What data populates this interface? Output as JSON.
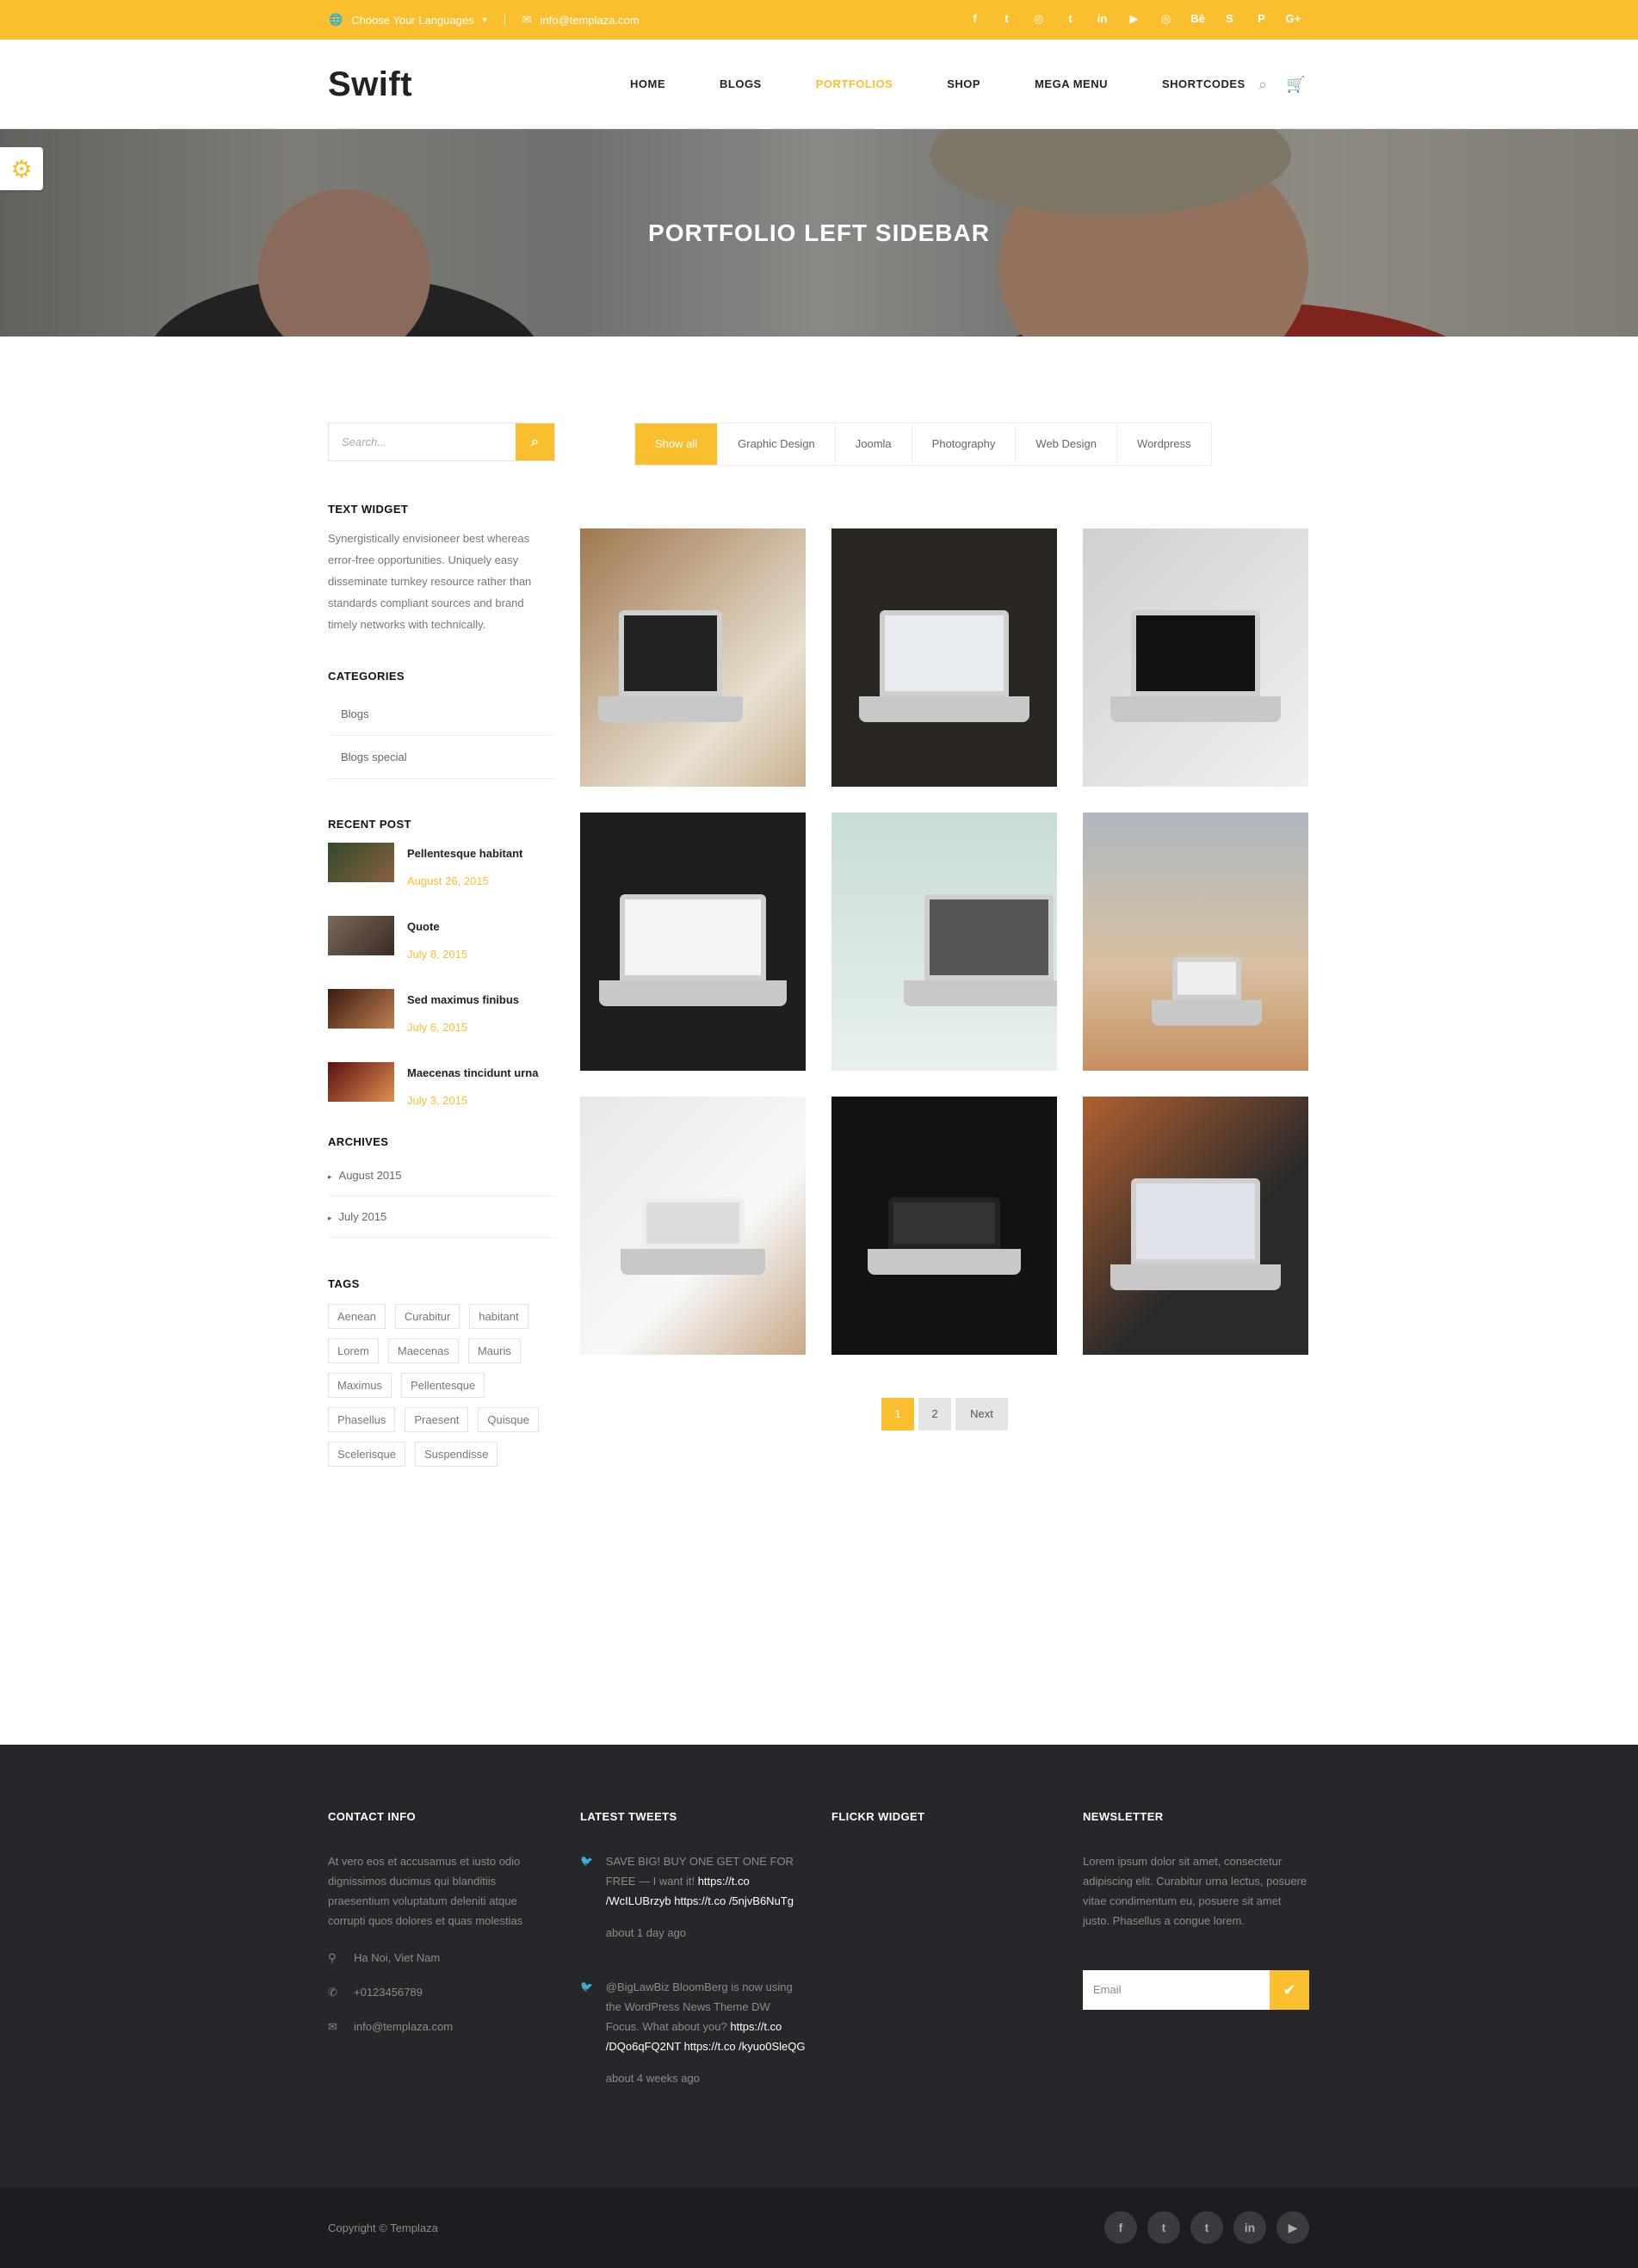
{
  "topbar": {
    "language": "Choose Your Languages",
    "email": "info@templaza.com",
    "social": [
      "f",
      "t",
      "◎",
      "t",
      "in",
      "▶",
      "◎",
      "Bē",
      "S",
      "P",
      "G+"
    ]
  },
  "header": {
    "logo": "Swift",
    "nav": [
      "HOME",
      "BLOGS",
      "PORTFOLIOS",
      "SHOP",
      "MEGA MENU",
      "SHORTCODES"
    ],
    "active": "PORTFOLIOS"
  },
  "banner": {
    "title": "PORTFOLIO LEFT SIDEBAR"
  },
  "sidebar": {
    "search_placeholder": "Search...",
    "text_widget": {
      "title": "TEXT WIDGET",
      "body": "Synergistically envisioneer best whereas error-free opportunities. Uniquely easy disseminate turnkey resource rather than standards compliant sources and brand timely networks with technically."
    },
    "categories": {
      "title": "CATEGORIES",
      "items": [
        "Blogs",
        "Blogs special"
      ]
    },
    "recent": {
      "title": "RECENT POST",
      "items": [
        {
          "title": "Pellentesque habitant",
          "date": "August 26, 2015"
        },
        {
          "title": "Quote",
          "date": "July 8, 2015"
        },
        {
          "title": "Sed maximus finibus",
          "date": "July 6, 2015"
        },
        {
          "title": "Maecenas tincidunt urna",
          "date": "July 3, 2015"
        }
      ]
    },
    "archives": {
      "title": "ARCHIVES",
      "items": [
        "August 2015",
        "July 2015"
      ]
    },
    "tags": {
      "title": "TAGS",
      "items": [
        "Aenean",
        "Curabitur",
        "habitant",
        "Lorem",
        "Maecenas",
        "Mauris",
        "Maximus",
        "Pellentesque",
        "Phasellus",
        "Praesent",
        "Quisque",
        "Scelerisque",
        "Suspendisse"
      ]
    }
  },
  "filters": [
    "Show all",
    "Graphic Design",
    "Joomla",
    "Photography",
    "Web Design",
    "Wordpress"
  ],
  "pager": {
    "pages": [
      "1",
      "2"
    ],
    "next": "Next"
  },
  "footer": {
    "contact": {
      "title": "CONTACT INFO",
      "text": "At vero eos et accusamus et iusto odio dignissimos ducimus qui blanditiis praesentium voluptatum deleniti atque corrupti quos dolores et quas molestias",
      "address": "Ha Noi, Viet Nam",
      "phone": "+0123456789",
      "email": "info@templaza.com"
    },
    "tweets": {
      "title": "LATEST TWEETS",
      "items": [
        {
          "grey": "SAVE BIG! BUY ONE GET ONE FOR FREE — I want it! ",
          "white": "https://t.co /WcILUBrzyb https://t.co /5njvB6NuTg",
          "ago": "about 1 day ago"
        },
        {
          "grey": "@BigLawBiz BloomBerg is now using the WordPress News Theme DW Focus. What about you? ",
          "white": "https://t.co /DQo6qFQ2NT https://t.co /kyuo0SleQG",
          "ago": "about 4 weeks ago"
        }
      ]
    },
    "flickr": {
      "title": "FLICKR WIDGET"
    },
    "newsletter": {
      "title": "NEWSLETTER",
      "text": "Lorem ipsum dolor sit amet, consectetur adipiscing elit. Curabitur urna lectus, posuere vitae condimentum eu, posuere sit amet justo. Phasellus a congue lorem.",
      "placeholder": "Email"
    }
  },
  "copyright": "Copyright © Templaza",
  "copyright_social": [
    "f",
    "t",
    "t",
    "in",
    "▶"
  ],
  "colors": {
    "accent": "#f9bf2f",
    "footer_bg": "#26272b",
    "copy_bg": "#1c1d20"
  }
}
